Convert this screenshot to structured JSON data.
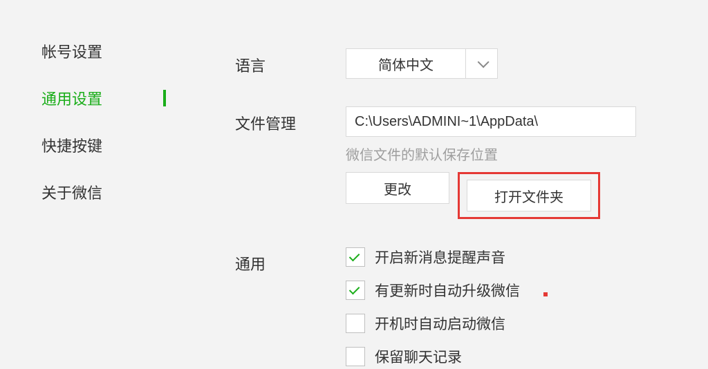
{
  "sidebar": {
    "items": [
      {
        "label": "帐号设置",
        "active": false
      },
      {
        "label": "通用设置",
        "active": true
      },
      {
        "label": "快捷按键",
        "active": false
      },
      {
        "label": "关于微信",
        "active": false
      }
    ]
  },
  "sections": {
    "language": {
      "label": "语言",
      "value": "简体中文"
    },
    "fileManagement": {
      "label": "文件管理",
      "path": "C:\\Users\\ADMINI~1\\AppData\\",
      "hint": "微信文件的默认保存位置",
      "buttons": {
        "change": "更改",
        "openFolder": "打开文件夹"
      }
    },
    "general": {
      "label": "通用",
      "options": [
        {
          "label": "开启新消息提醒声音",
          "checked": true
        },
        {
          "label": "有更新时自动升级微信",
          "checked": true
        },
        {
          "label": "开机时自动启动微信",
          "checked": false
        },
        {
          "label": "保留聊天记录",
          "checked": false
        }
      ]
    }
  }
}
